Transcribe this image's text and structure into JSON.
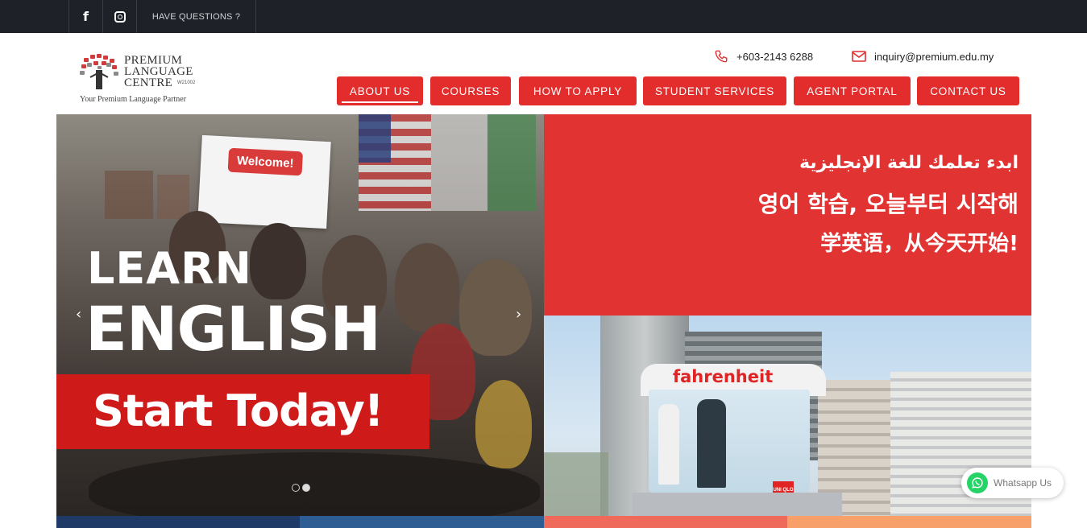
{
  "topbar": {
    "facebook_icon": "f",
    "instagram_icon": "instagram-icon",
    "questions": "HAVE QUESTIONS ?"
  },
  "logo": {
    "line1": "PREMIUM",
    "line2": "LANGUAGE",
    "line3": "CENTRE",
    "reg": "W21002",
    "tagline": "Your Premium Language Partner"
  },
  "contact": {
    "phone": "+603-2143 6288",
    "email": "inquiry@premium.edu.my"
  },
  "nav": {
    "items": [
      {
        "label": "ABOUT US"
      },
      {
        "label": "COURSES"
      },
      {
        "label": "HOW TO APPLY"
      },
      {
        "label": "STUDENT SERVICES"
      },
      {
        "label": "AGENT PORTAL"
      },
      {
        "label": "CONTACT US"
      }
    ]
  },
  "hero": {
    "welcome_sign": "Welcome!",
    "learn": "LEARN",
    "english": "ENGLISH",
    "start": "Start Today!",
    "prev_arrow": "‹",
    "next_arrow": "›",
    "arabic": "ابدء تعلمك للغة الإنجليزية",
    "korean": "영어 학습, 오늘부터 시작해",
    "chinese": "学英语，从今天开始!",
    "store_sign": "fahrenheit",
    "store_brand": "UNI QLO"
  },
  "whatsapp": {
    "label": "Whatsapp Us"
  },
  "colors": {
    "brand_red": "#e32d2d",
    "topbar": "#1e2127",
    "strip_navy": "#1f3a66",
    "strip_blue": "#2e5d94",
    "strip_salmon": "#f06a5b",
    "strip_orange": "#f7a06a"
  }
}
